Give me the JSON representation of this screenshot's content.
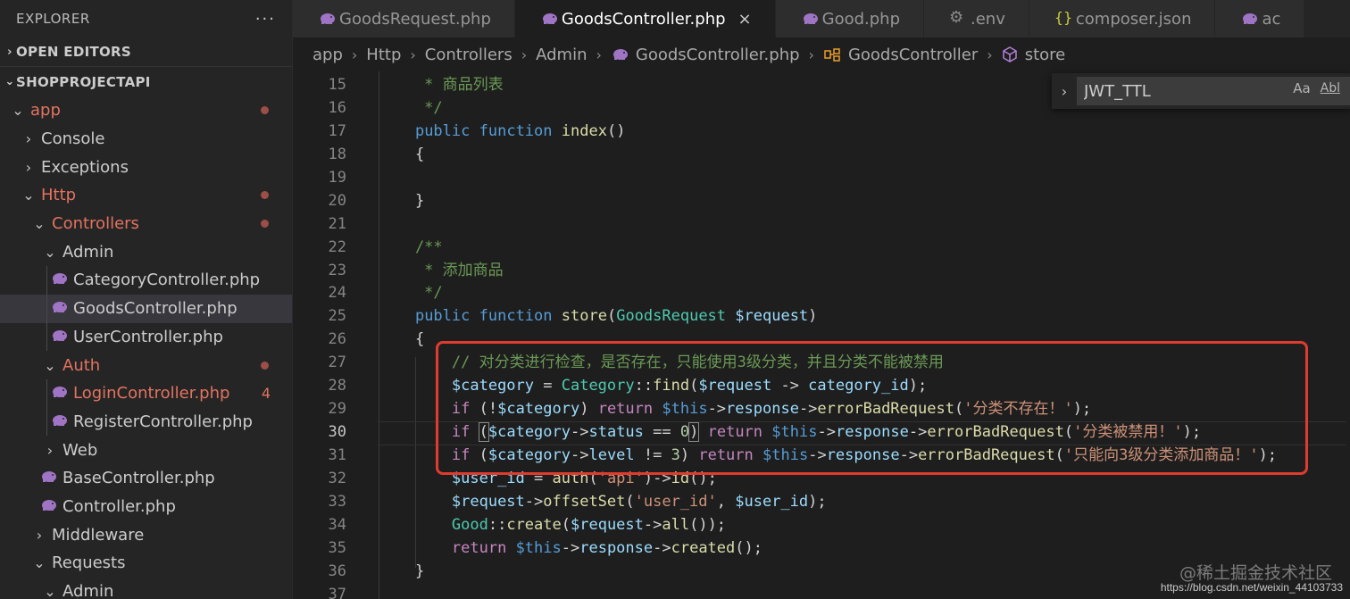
{
  "sidebar": {
    "header": "EXPLORER",
    "more": "···",
    "open_editors": "OPEN EDITORS",
    "project": "SHOPPROJECTAPI",
    "tree": {
      "app": "app",
      "console": "Console",
      "exceptions": "Exceptions",
      "http": "Http",
      "controllers": "Controllers",
      "admin": "Admin",
      "category_controller": "CategoryController.php",
      "goods_controller": "GoodsController.php",
      "user_controller": "UserController.php",
      "auth": "Auth",
      "login_controller": "LoginController.php",
      "login_count": "4",
      "register_controller": "RegisterController.php",
      "web": "Web",
      "base_controller": "BaseController.php",
      "controller": "Controller.php",
      "middleware": "Middleware",
      "requests": "Requests",
      "admin2": "Admin"
    }
  },
  "tabs": {
    "t1": "GoodsRequest.php",
    "t2": "GoodsController.php",
    "t2_close": "×",
    "t3": "Good.php",
    "t4": ".env",
    "t5": "composer.json",
    "t6": "ac"
  },
  "breadcrumb": {
    "b1": "app",
    "b2": "Http",
    "b3": "Controllers",
    "b4": "Admin",
    "b5": "GoodsController.php",
    "b6": "GoodsController",
    "b7": "store"
  },
  "find": {
    "value": "JWT_TTL",
    "match_case": "Aa",
    "whole_word": "Abl"
  },
  "editor": {
    "line_numbers": [
      "15",
      "16",
      "17",
      "18",
      "19",
      "20",
      "21",
      "22",
      "23",
      "24",
      "25",
      "26",
      "27",
      "28",
      "29",
      "30",
      "31",
      "32",
      "33",
      "34",
      "35",
      "36",
      "37"
    ],
    "current_line": "30"
  },
  "watermark": {
    "site": "@稀土掘金技术社区",
    "url": "https://blog.csdn.net/weixin_44103733"
  },
  "colors": {
    "modified": "#e2735f",
    "highlight_box": "#e03b2f",
    "php_icon": "#a074c4"
  }
}
